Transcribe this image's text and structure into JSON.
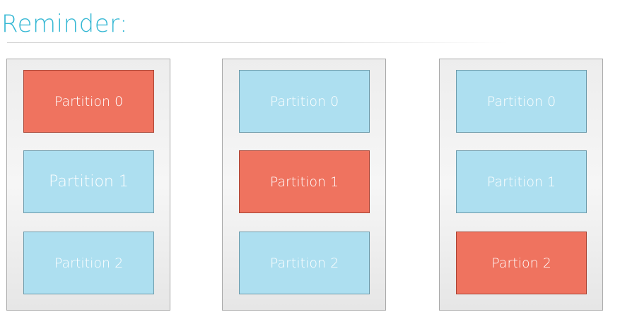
{
  "title": "Reminder:",
  "colors": {
    "title": "#36b8d4",
    "leader": "#ef735f",
    "follower": "#addff0"
  },
  "brokers": [
    {
      "partitions": [
        {
          "label": "Partition 0",
          "role": "leader"
        },
        {
          "label": "Partition 1",
          "role": "follower"
        },
        {
          "label": "Partition 2",
          "role": "follower"
        }
      ]
    },
    {
      "partitions": [
        {
          "label": "Partition 0",
          "role": "follower"
        },
        {
          "label": "Partition 1",
          "role": "leader"
        },
        {
          "label": "Partition 2",
          "role": "follower"
        }
      ]
    },
    {
      "partitions": [
        {
          "label": "Partition 0",
          "role": "follower"
        },
        {
          "label": "Partition 1",
          "role": "follower"
        },
        {
          "label": "Partion 2",
          "role": "leader"
        }
      ]
    }
  ]
}
